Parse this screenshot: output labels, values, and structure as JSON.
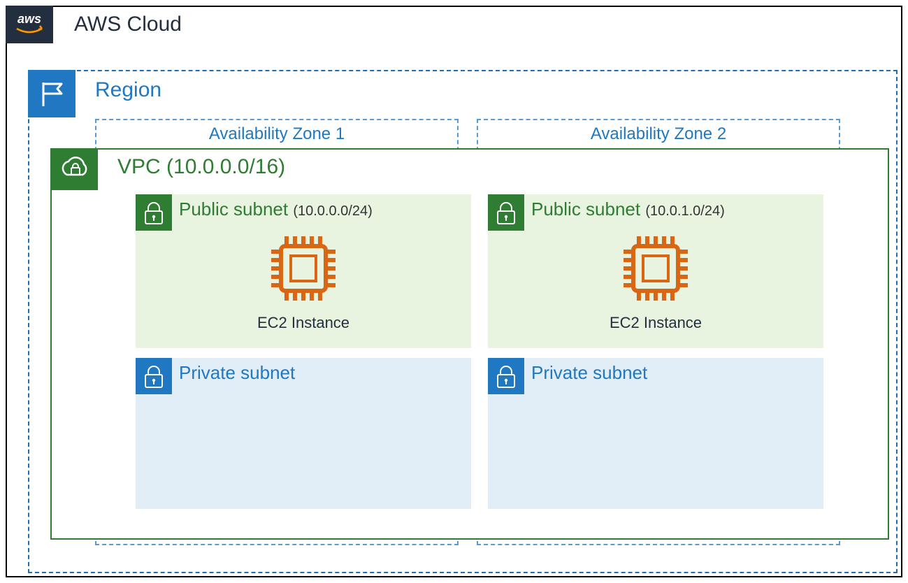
{
  "cloud": {
    "title": "AWS Cloud"
  },
  "region": {
    "title": "Region"
  },
  "vpc": {
    "title": "VPC (10.0.0.0/16)"
  },
  "az": [
    {
      "title": "Availability Zone 1"
    },
    {
      "title": "Availability Zone 2"
    }
  ],
  "subnets": {
    "public": [
      {
        "title": "Public subnet",
        "cidr": "(10.0.0.0/24)",
        "instance_label": "EC2 Instance"
      },
      {
        "title": "Public subnet",
        "cidr": "(10.0.1.0/24)",
        "instance_label": "EC2 Instance"
      }
    ],
    "private": [
      {
        "title": "Private subnet"
      },
      {
        "title": "Private subnet"
      }
    ]
  },
  "colors": {
    "aws_dark": "#232f3e",
    "region_blue": "#1f78c1",
    "vpc_green": "#2e7d32",
    "ec2_orange": "#d86613",
    "public_fill": "#e8f3e0",
    "private_fill": "#e1eef7"
  }
}
